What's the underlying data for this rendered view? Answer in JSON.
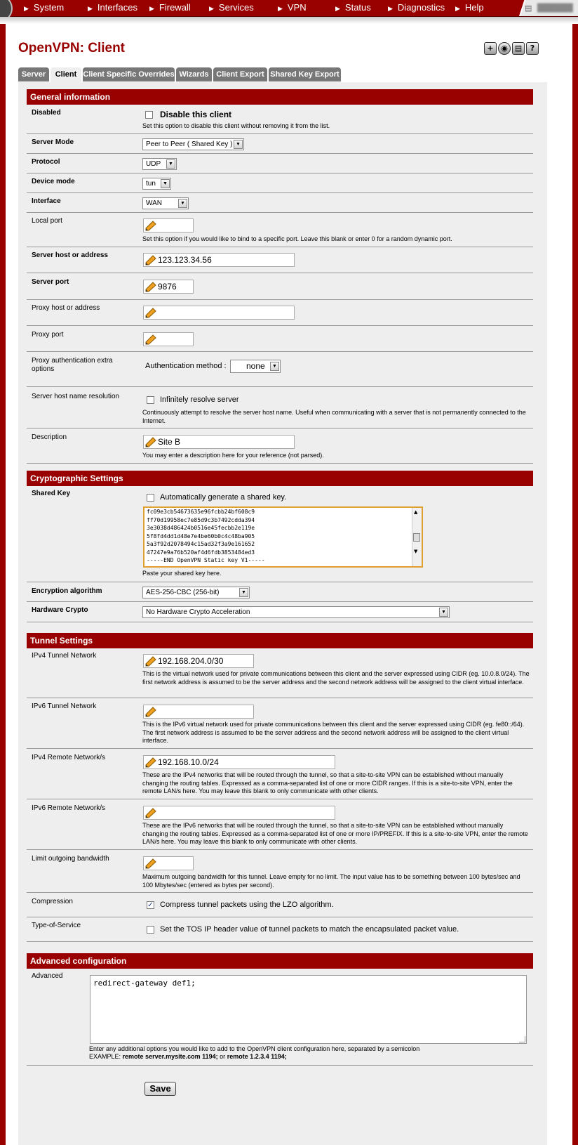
{
  "nav": {
    "items": [
      "System",
      "Interfaces",
      "Firewall",
      "Services",
      "VPN",
      "Status",
      "Diagnostics",
      "Help"
    ]
  },
  "page_title": "OpenVPN: Client",
  "tabs": [
    "Server",
    "Client",
    "Client Specific Overrides",
    "Wizards",
    "Client Export",
    "Shared Key Export"
  ],
  "active_tab": "Client",
  "general": {
    "header": "General information",
    "disabled_label": "Disabled",
    "disabled_check_label": "Disable this client",
    "disabled_note": "Set this option to disable this client without removing it from the list.",
    "server_mode_label": "Server Mode",
    "server_mode_value": "Peer to Peer ( Shared Key )",
    "protocol_label": "Protocol",
    "protocol_value": "UDP",
    "device_mode_label": "Device mode",
    "device_mode_value": "tun",
    "interface_label": "Interface",
    "interface_value": "WAN",
    "local_port_label": "Local port",
    "local_port_value": "",
    "local_port_note": "Set this option if you would like to bind to a specific port. Leave this blank or enter 0 for a random dynamic port.",
    "server_host_label": "Server host or address",
    "server_host_value": "123.123.34.56",
    "server_port_label": "Server port",
    "server_port_value": "9876",
    "proxy_host_label": "Proxy host or address",
    "proxy_host_value": "",
    "proxy_port_label": "Proxy port",
    "proxy_port_value": "",
    "proxy_auth_label": "Proxy authentication extra options",
    "auth_method_label": "Authentication method :",
    "auth_method_value": "none",
    "resolution_label": "Server host name resolution",
    "resolution_check_label": "Infinitely resolve server",
    "resolution_note": "Continuously attempt to resolve the server host name. Useful when communicating with a server that is not permanently connected to the Internet.",
    "description_label": "Description",
    "description_value": "Site B",
    "description_note": "You may enter a description here for your reference (not parsed)."
  },
  "crypto": {
    "header": "Cryptographic Settings",
    "shared_key_label": "Shared Key",
    "autogen_label": "Automatically generate a shared key.",
    "key_lines": [
      "fc09e3cb54673635e96fcbb24bf608c9",
      "ff70d19958ec7e85d9c3b7492cdda394",
      "3e3038d486424b0516e45fecbb2e119e",
      "5f8fd4dd1d48e7e4be60b0c4c48ba905",
      "5a3f92d2078494c15ad32f3a9e161652",
      "47247e9a76b520af4d6fdb3853484ed3",
      "-----END OpenVPN Static key V1-----"
    ],
    "key_note": "Paste your shared key here.",
    "encryption_label": "Encryption algorithm",
    "encryption_value": "AES-256-CBC (256-bit)",
    "hw_crypto_label": "Hardware Crypto",
    "hw_crypto_value": "No Hardware Crypto Acceleration"
  },
  "tunnel": {
    "header": "Tunnel Settings",
    "ipv4_tunnel_label": "IPv4 Tunnel Network",
    "ipv4_tunnel_value": "192.168.204.0/30",
    "ipv4_tunnel_note": "This is the virtual network used for private communications between this client and the server expressed using CIDR (eg. 10.0.8.0/24). The first network address is assumed to be the server address and the second network address will be assigned to the client virtual interface.",
    "ipv6_tunnel_label": "IPv6 Tunnel Network",
    "ipv6_tunnel_value": "",
    "ipv6_tunnel_note": "This is the IPv6 virtual network used for private communications between this client and the server expressed using CIDR (eg. fe80::/64). The first network address is assumed to be the server address and the second network address will be assigned to the client virtual interface.",
    "ipv4_remote_label": "IPv4 Remote Network/s",
    "ipv4_remote_value": "192.168.10.0/24",
    "ipv4_remote_note": "These are the IPv4 networks that will be routed through the tunnel, so that a site-to-site VPN can be established without manually changing the routing tables. Expressed as a comma-separated list of one or more CIDR ranges. If this is a site-to-site VPN, enter the remote LAN/s here. You may leave this blank to only communicate with other clients.",
    "ipv6_remote_label": "IPv6 Remote Network/s",
    "ipv6_remote_value": "",
    "ipv6_remote_note": "These are the IPv6 networks that will be routed through the tunnel, so that a site-to-site VPN can be established without manually changing the routing tables. Expressed as a comma-separated list of one or more IP/PREFIX. If this is a site-to-site VPN, enter the remote LAN/s here. You may leave this blank to only communicate with other clients.",
    "bandwidth_label": "Limit outgoing bandwidth",
    "bandwidth_value": "",
    "bandwidth_note": "Maximum outgoing bandwidth for this tunnel. Leave empty for no limit. The input value has to be something between 100 bytes/sec and 100 Mbytes/sec (entered as bytes per second).",
    "compression_label": "Compression",
    "compression_check_label": "Compress tunnel packets using the LZO algorithm.",
    "compression_checked": true,
    "tos_label": "Type-of-Service",
    "tos_check_label": "Set the TOS IP header value of tunnel packets to match the encapsulated packet value."
  },
  "advanced": {
    "header": "Advanced configuration",
    "label": "Advanced",
    "value": "redirect-gateway def1;",
    "note": "Enter any additional options you would like to add to the OpenVPN client configuration here, separated by a semicolon",
    "example_prefix": "EXAMPLE:",
    "example_1": "remote server.mysite.com 1194;",
    "example_or": "or",
    "example_2": "remote 1.2.3.4 1194;"
  },
  "save_label": "Save",
  "colors": {
    "brand": "#990000",
    "tab_inactive": "#777777",
    "panel": "#eeeeee"
  }
}
